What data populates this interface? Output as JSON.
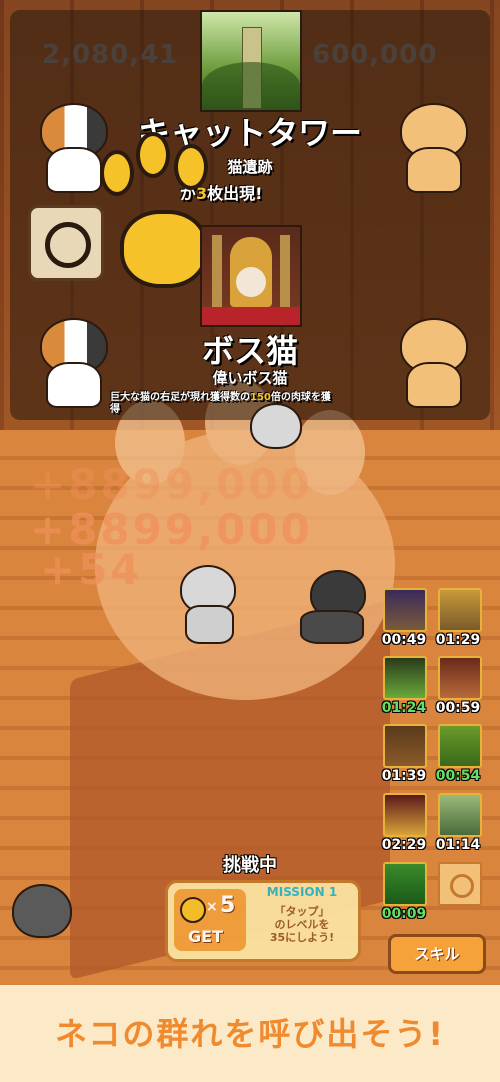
{
  "header": {
    "score_left": "2,080,41",
    "score_right": "600,000"
  },
  "stage_card": {
    "title": "キャットタワー",
    "subtitle": "猫遺跡",
    "desc_prefix": "が",
    "desc_count": "3",
    "desc_suffix": "枚出現!"
  },
  "boss_card": {
    "title": "ボス猫",
    "subtitle": "偉いボス猫",
    "desc_prefix": "巨大な猫の右足が現れ獲得数の",
    "desc_number": "150",
    "desc_suffix": "倍の肉球を獲",
    "desc_line2": "得"
  },
  "floating_numbers": [
    "+8899,000",
    "+54",
    "+5"
  ],
  "tiles": [
    {
      "time": "00:49",
      "green": false
    },
    {
      "time": "01:29",
      "green": false
    },
    {
      "time": "01:24",
      "green": true
    },
    {
      "time": "00:59",
      "green": false
    },
    {
      "time": "01:39",
      "green": false
    },
    {
      "time": "00:54",
      "green": true
    },
    {
      "time": "02:29",
      "green": false
    },
    {
      "time": "01:14",
      "green": false
    },
    {
      "time": "00:09",
      "green": true
    }
  ],
  "status": {
    "challenge_label": "挑戦中"
  },
  "mission": {
    "title": "MISSION 1",
    "reward_multiplier": "×",
    "reward_amount": "5",
    "reward_label": "GET",
    "text_line1": "「タップ」",
    "text_line2": "のレベルを",
    "text_line3": "35にしよう!"
  },
  "skill_button": {
    "label": "スキル"
  },
  "banner": {
    "text": "ネコの群れを呼び出そう!"
  },
  "colors": {
    "accent_orange": "#f08a2e",
    "gold": "#f6c22a",
    "timer_green": "#63e06a",
    "mission_title": "#2fb7c6"
  },
  "icons": {
    "reward": "paw-icon",
    "skill": "paw-icon",
    "settings": "gear-icon"
  }
}
